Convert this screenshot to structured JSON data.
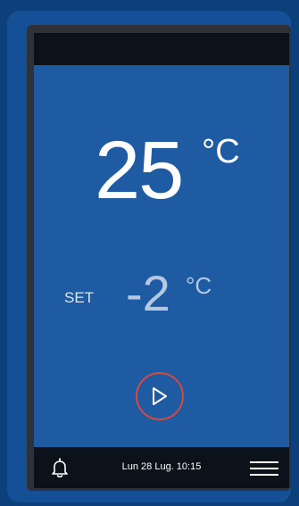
{
  "display": {
    "current_temperature": "25",
    "current_unit": "°C",
    "set_label": "SET",
    "set_temperature": "-2",
    "set_unit": "°C"
  },
  "status_bar": {
    "datetime": "Lun 28 Lug. 10:15"
  },
  "icons": {
    "start": "play-icon",
    "notifications": "bell-icon",
    "menu": "hamburger-menu-icon"
  },
  "colors": {
    "screen_background": "#1f5ba3",
    "start_ring": "#d6493e",
    "bars": "#0c1219"
  }
}
